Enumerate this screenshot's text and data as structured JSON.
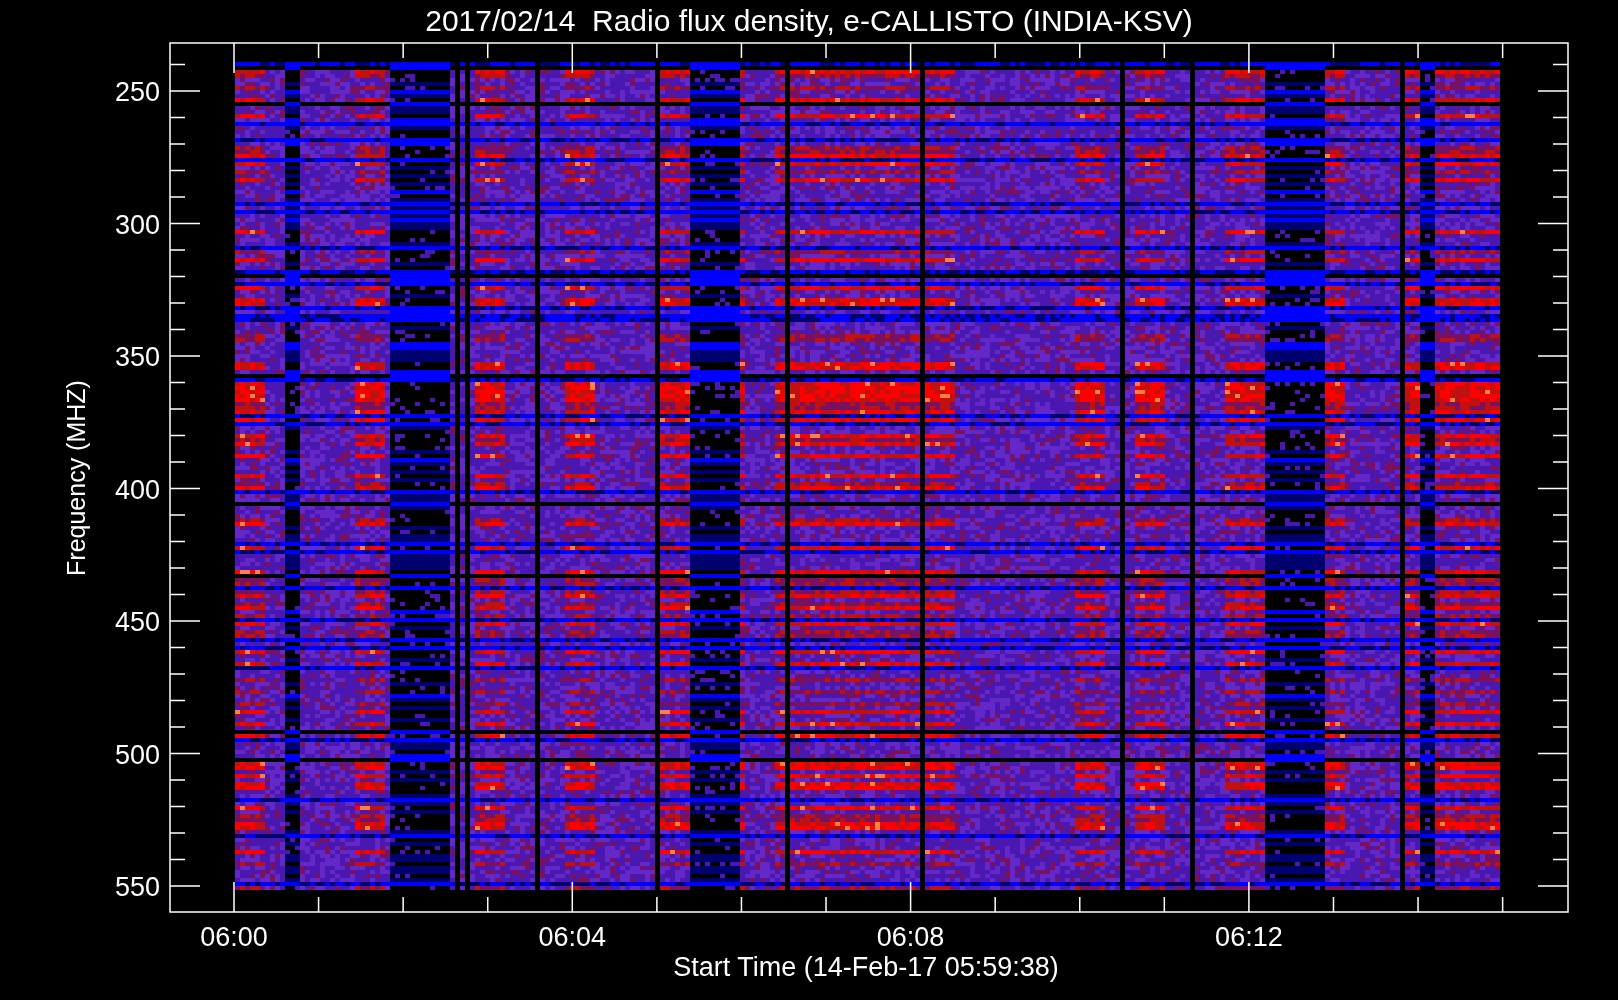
{
  "plot": {
    "title": "2017/02/14  Radio flux density, e-CALLISTO (INDIA-KSV)",
    "y_axis": {
      "label": "Frequency (MHZ)",
      "ticks": [
        "250",
        "300",
        "350",
        "400",
        "450",
        "500",
        "550"
      ]
    },
    "x_axis": {
      "label": "Start Time (14-Feb-17 05:59:38)",
      "ticks": [
        "06:00",
        "06:04",
        "06:08",
        "06:12"
      ]
    }
  }
}
